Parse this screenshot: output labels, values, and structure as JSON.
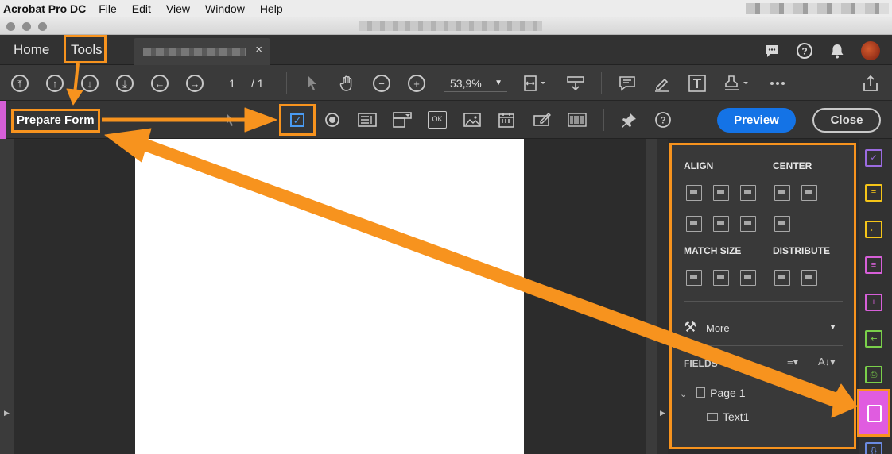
{
  "menubar": {
    "app_name": "Acrobat Pro DC",
    "items": [
      "File",
      "Edit",
      "View",
      "Window",
      "Help"
    ]
  },
  "tabs": {
    "home": "Home",
    "tools": "Tools",
    "close_glyph": "×"
  },
  "toolbar": {
    "page_current": "1",
    "page_total": "/ 1",
    "zoom": "53,9%"
  },
  "formbar": {
    "title": "Prepare Form",
    "preview_label": "Preview",
    "close_label": "Close"
  },
  "panel": {
    "align": "ALIGN",
    "center": "CENTER",
    "match_size": "MATCH SIZE",
    "distribute": "DISTRIBUTE",
    "more": "More",
    "fields": "FIELDS",
    "tree": {
      "page": "Page 1",
      "field": "Text1"
    }
  },
  "colors": {
    "annotation": "#f7931e",
    "accent": "#d65fd8",
    "primary_button": "#1473e6"
  }
}
